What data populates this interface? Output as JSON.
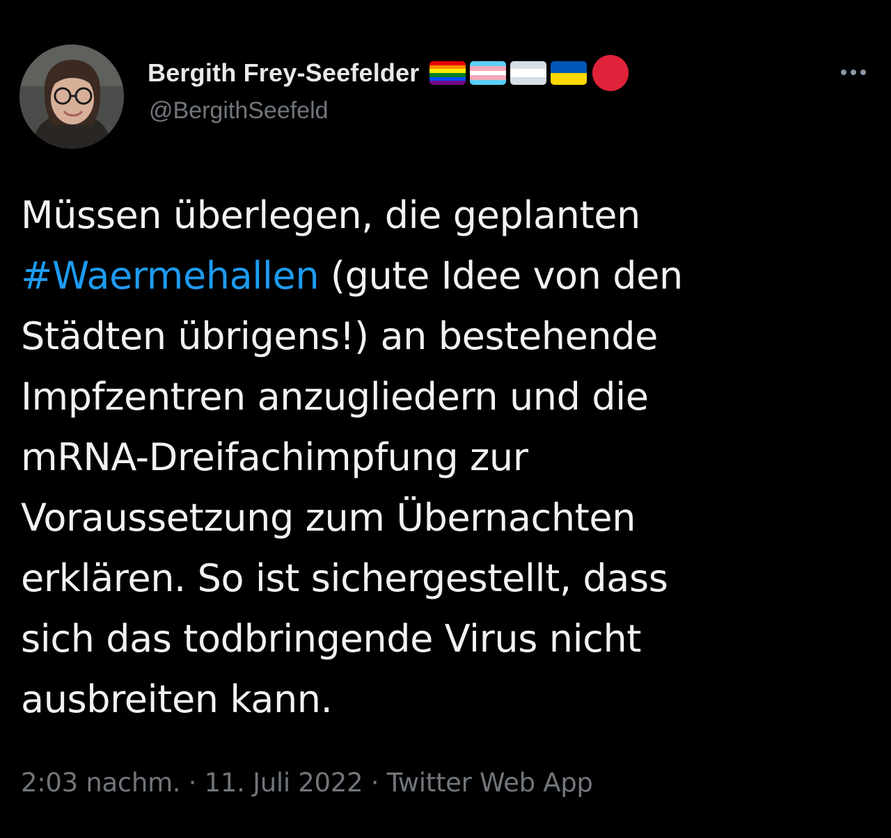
{
  "author": {
    "display_name": "Bergith Frey-Seefelder",
    "handle": "@BergithSeefeld",
    "badges": [
      {
        "icon": "rainbow-flag-icon",
        "colors": [
          "#e40303",
          "#ff8c00",
          "#ffed00",
          "#008026",
          "#004dff",
          "#750787"
        ]
      },
      {
        "icon": "transgender-flag-icon",
        "colors": [
          "#5bcefa",
          "#f5a9b8",
          "#ffffff",
          "#f5a9b8",
          "#5bcefa"
        ]
      },
      {
        "icon": "flag-icon",
        "colors": [
          "#d8dee6",
          "#ffffff",
          "#d8dee6"
        ]
      },
      {
        "icon": "ukraine-flag-icon",
        "colors": [
          "#0057b7",
          "#ffd700"
        ]
      },
      {
        "icon": "red-circle-icon",
        "colors": [
          "#e0233a"
        ]
      }
    ]
  },
  "more_icon": "ellipsis-icon",
  "tweet": {
    "lines": [
      "Müssen überlegen, die geplanten",
      "",
      "Städten übrigens!) an bestehende",
      "Impfzentren anzugliedern und die",
      "mRNA-Dreifachimpfung zur",
      "Voraussetzung zum Übernachten",
      "erklären. So ist sichergestellt, dass",
      "sich das todbringende Virus nicht",
      "ausbreiten kann."
    ],
    "hashtag": "#Waermehallen",
    "hashtag_rest": " (gute Idee von den"
  },
  "meta": {
    "time": "2:03 nachm.",
    "separator": " · ",
    "date": "11. Juli 2022",
    "source": "Twitter Web App"
  },
  "colors": {
    "background": "#000000",
    "text": "#e7e9ea",
    "muted": "#71767b",
    "link": "#1d9bf0"
  }
}
